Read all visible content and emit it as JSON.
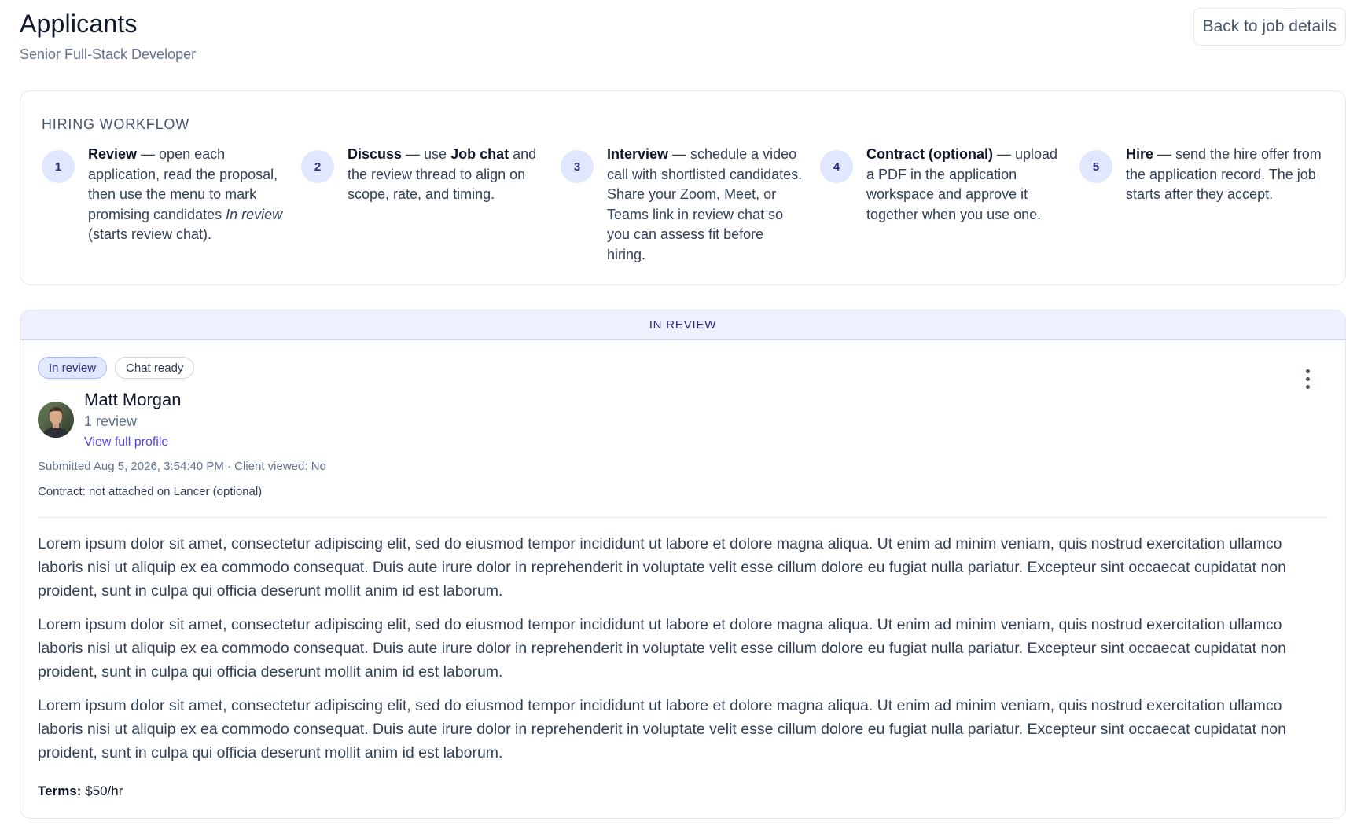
{
  "header": {
    "title": "Applicants",
    "subtitle": "Senior Full-Stack Developer",
    "back_label": "Back to job details"
  },
  "workflow": {
    "title": "HIRING WORKFLOW",
    "steps": [
      {
        "num": "1",
        "name": "Review",
        "text": " — open each application, read the proposal, then use the menu to mark promising candidates ",
        "em": "In review",
        "tail": " (starts review chat)."
      },
      {
        "num": "2",
        "name": "Discuss",
        "pre": " — use ",
        "bold2": "Job chat",
        "text": " and the review thread to align on scope, rate, and timing."
      },
      {
        "num": "3",
        "name": "Interview",
        "text": " — schedule a video call with shortlisted candidates. Share your Zoom, Meet, or Teams link in review chat so you can assess fit before hiring."
      },
      {
        "num": "4",
        "name": "Contract (optional)",
        "text": " — upload a PDF in the application workspace and approve it together when you use one."
      },
      {
        "num": "5",
        "name": "Hire",
        "text": " — send the hire offer from the application record. The job starts after they accept."
      }
    ]
  },
  "section": {
    "label": "IN REVIEW"
  },
  "applicant": {
    "badges": [
      "In review",
      "Chat ready"
    ],
    "name": "Matt Morgan",
    "reviews": "1 review",
    "profile_link": "View full profile",
    "submitted": "Submitted Aug 5, 2026, 3:54:40 PM · Client viewed: No",
    "contract": "Contract: not attached on Lancer (optional)",
    "proposal": [
      "Lorem ipsum dolor sit amet, consectetur adipiscing elit, sed do eiusmod tempor incididunt ut labore et dolore magna aliqua. Ut enim ad minim veniam, quis nostrud exercitation ullamco laboris nisi ut aliquip ex ea commodo consequat. Duis aute irure dolor in reprehenderit in voluptate velit esse cillum dolore eu fugiat nulla pariatur. Excepteur sint occaecat cupidatat non proident, sunt in culpa qui officia deserunt mollit anim id est laborum.",
      "Lorem ipsum dolor sit amet, consectetur adipiscing elit, sed do eiusmod tempor incididunt ut labore et dolore magna aliqua. Ut enim ad minim veniam, quis nostrud exercitation ullamco laboris nisi ut aliquip ex ea commodo consequat. Duis aute irure dolor in reprehenderit in voluptate velit esse cillum dolore eu fugiat nulla pariatur. Excepteur sint occaecat cupidatat non proident, sunt in culpa qui officia deserunt mollit anim id est laborum.",
      "Lorem ipsum dolor sit amet, consectetur adipiscing elit, sed do eiusmod tempor incididunt ut labore et dolore magna aliqua. Ut enim ad minim veniam, quis nostrud exercitation ullamco laboris nisi ut aliquip ex ea commodo consequat. Duis aute irure dolor in reprehenderit in voluptate velit esse cillum dolore eu fugiat nulla pariatur. Excepteur sint occaecat cupidatat non proident, sunt in culpa qui officia deserunt mollit anim id est laborum."
    ],
    "terms_label": "Terms:",
    "terms_value": " $50/hr",
    "menu_icon": "more-vertical-icon"
  },
  "colors": {
    "accent": "#4f46e5",
    "badge_bg": "#e0e7ff",
    "section_header_bg": "#eef0fd"
  }
}
